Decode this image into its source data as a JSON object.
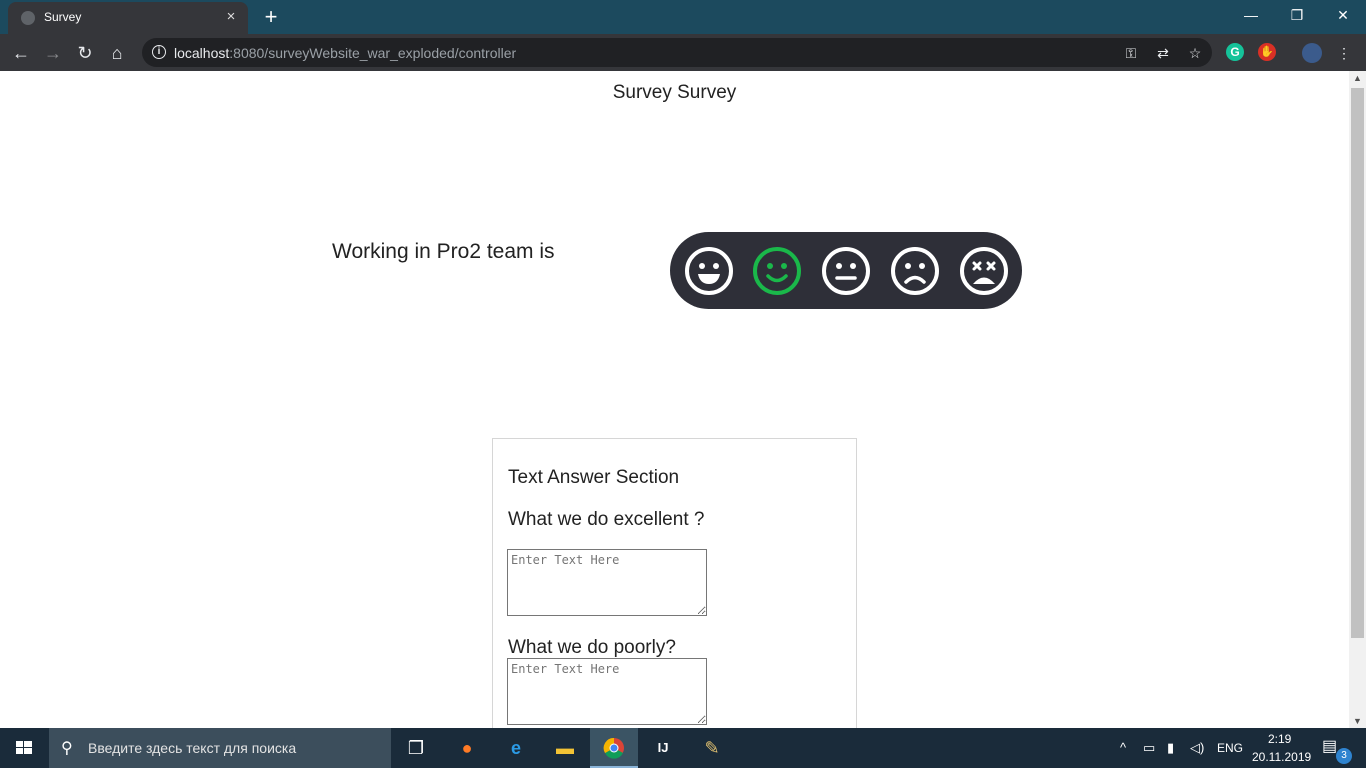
{
  "browser": {
    "tab_title": "Survey",
    "tab_close": "×",
    "new_tab": "+",
    "url_host": "localhost",
    "url_rest": ":8080/surveyWebsite_war_exploded/controller",
    "window": {
      "minimize": "—",
      "restore": "❐",
      "close": "✕"
    }
  },
  "page": {
    "title": "Survey Survey",
    "question": "Working in Pro2 team is",
    "rating": {
      "options": [
        "very-happy",
        "happy",
        "neutral",
        "sad",
        "very-sad"
      ],
      "selected": "happy",
      "selected_color": "#1ab84a",
      "default_color": "#ffffff",
      "background": "#2e2f38"
    },
    "text_section": {
      "title": "Text Answer Section",
      "q1_label": "What we do excellent ?",
      "q1_placeholder": "Enter Text Here",
      "q2_label": "What we do poorly?",
      "q2_placeholder": "Enter Text Here"
    }
  },
  "taskbar": {
    "search_placeholder": "Введите здесь текст для поиска",
    "language": "ENG",
    "time": "2:19",
    "date": "20.11.2019",
    "notification_count": "3"
  }
}
